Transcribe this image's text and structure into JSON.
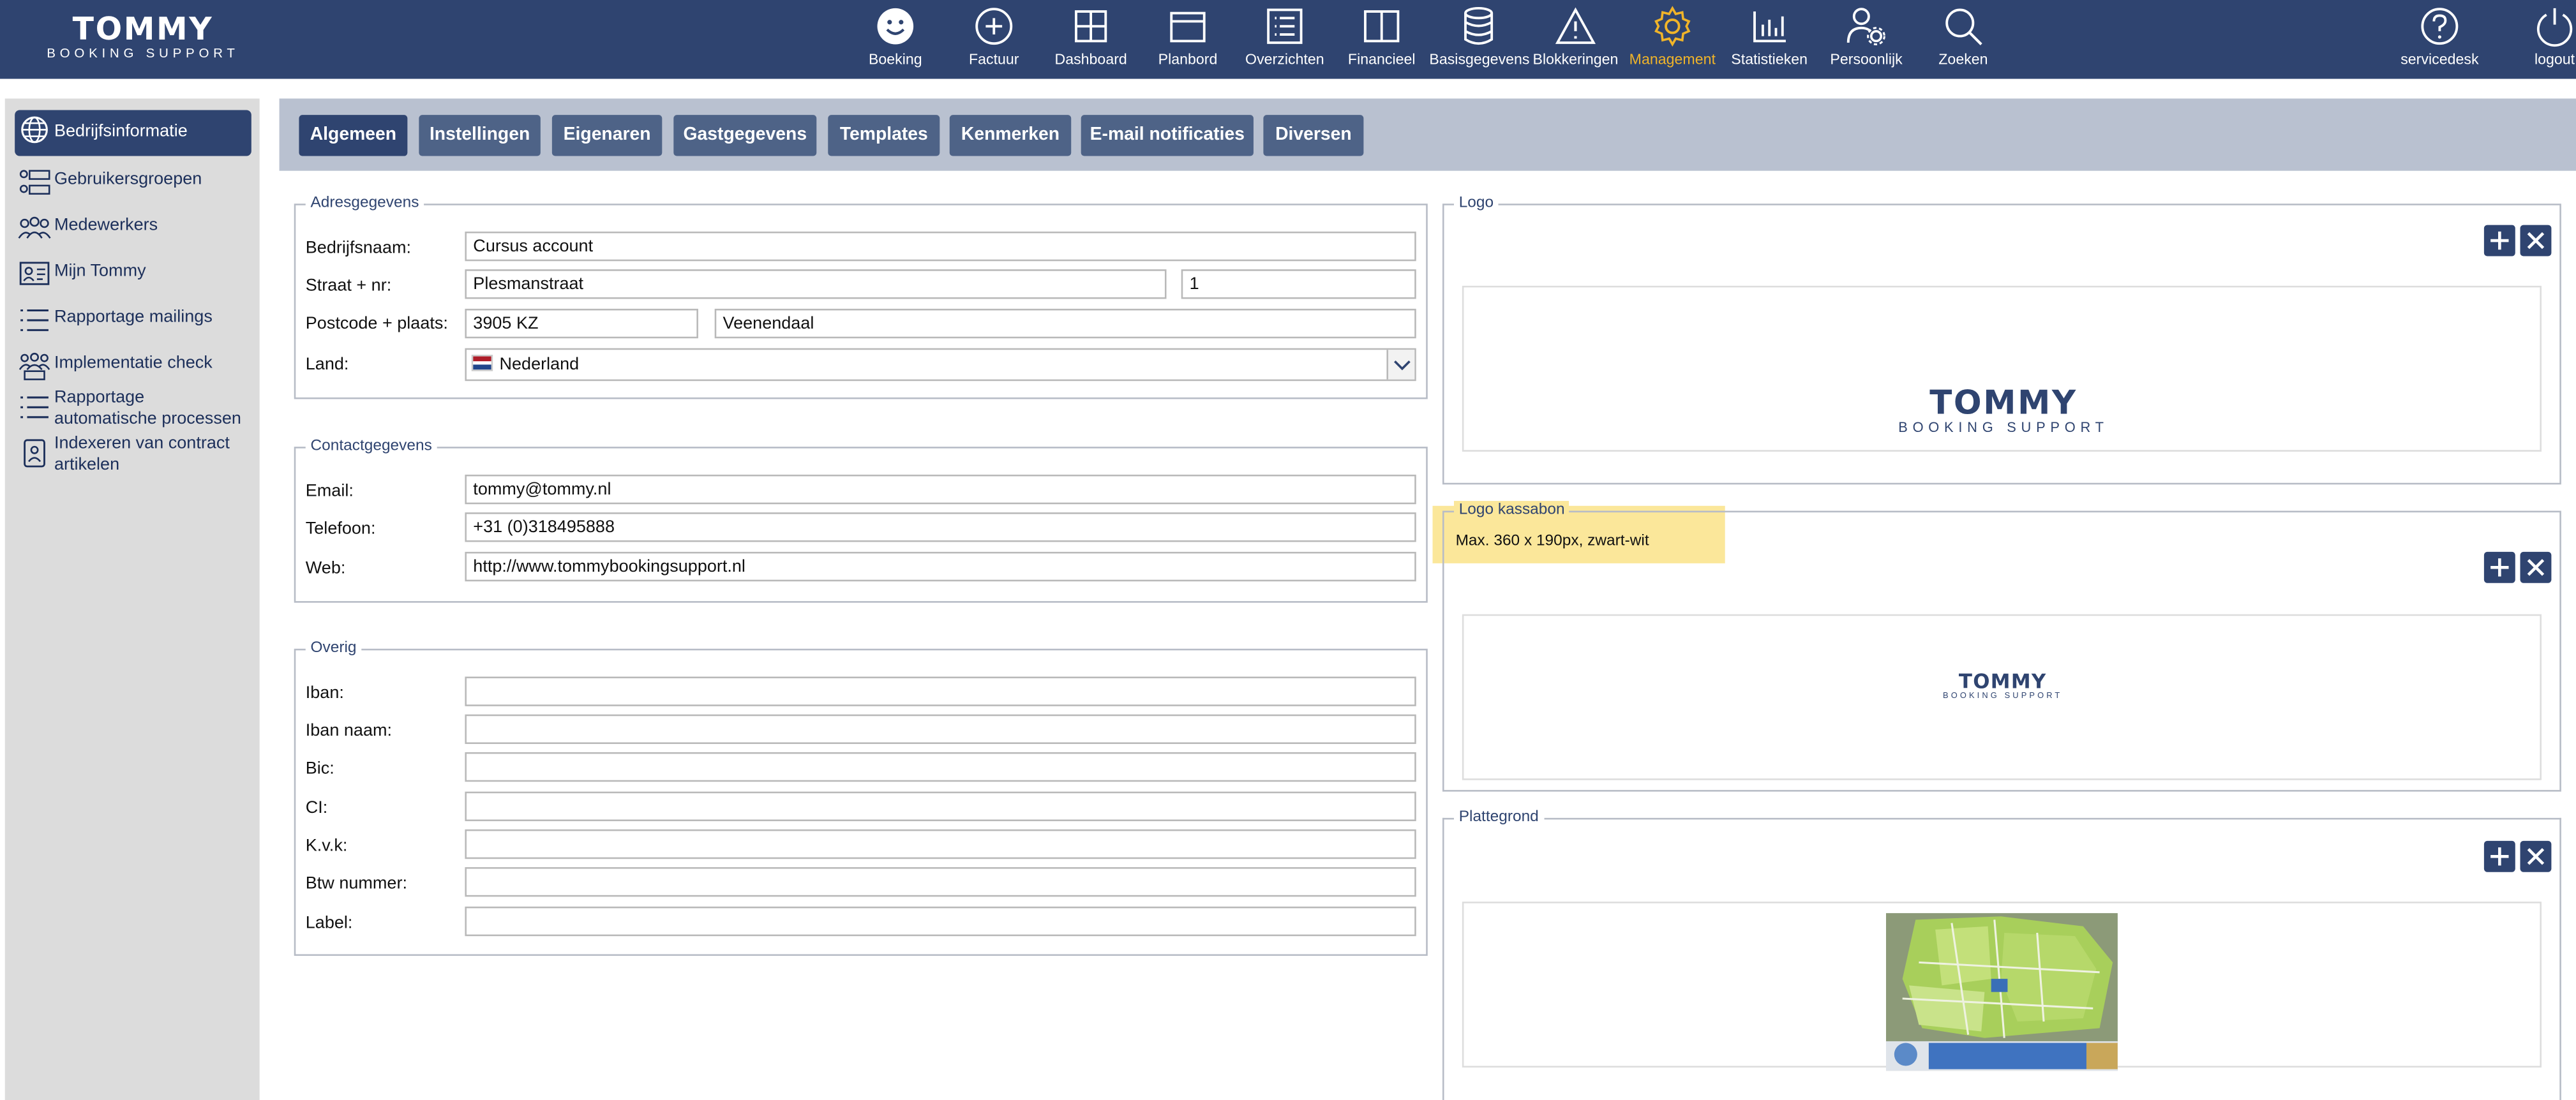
{
  "app": {
    "brand": "TOMMY",
    "brand_sub": "BOOKING SUPPORT"
  },
  "nav": {
    "items": [
      {
        "label": "Boeking",
        "icon": "smiley-icon"
      },
      {
        "label": "Factuur",
        "icon": "plus-circle-icon"
      },
      {
        "label": "Dashboard",
        "icon": "grid-icon"
      },
      {
        "label": "Planbord",
        "icon": "planboard-icon"
      },
      {
        "label": "Overzichten",
        "icon": "list-icon"
      },
      {
        "label": "Financieel",
        "icon": "book-icon"
      },
      {
        "label": "Basisgegevens",
        "icon": "database-icon"
      },
      {
        "label": "Blokkeringen",
        "icon": "warning-icon"
      },
      {
        "label": "Management",
        "icon": "gear-icon",
        "active": true
      },
      {
        "label": "Statistieken",
        "icon": "bar-chart-icon"
      },
      {
        "label": "Persoonlijk",
        "icon": "user-gear-icon"
      },
      {
        "label": "Zoeken",
        "icon": "search-icon"
      },
      {
        "label": "servicedesk",
        "icon": "help-icon"
      },
      {
        "label": "logout",
        "icon": "power-icon"
      }
    ],
    "active_color": "#f0b429",
    "bar_color": "#2f4470"
  },
  "sidebar": {
    "items": [
      {
        "label": "Bedrijfsinformatie",
        "icon": "globe-icon",
        "active": true
      },
      {
        "label": "Gebruikersgroepen",
        "icon": "groups-icon"
      },
      {
        "label": "Medewerkers",
        "icon": "people-icon"
      },
      {
        "label": "Mijn Tommy",
        "icon": "id-card-icon"
      },
      {
        "label": "Rapportage mailings",
        "icon": "list-icon"
      },
      {
        "label": "Implementatie check",
        "icon": "people-check-icon"
      },
      {
        "label": "Rapportage automatische processen",
        "icon": "list-icon"
      },
      {
        "label": "Indexeren van contract artikelen",
        "icon": "contract-icon"
      }
    ]
  },
  "tabs": [
    {
      "label": "Algemeen",
      "active": true
    },
    {
      "label": "Instellingen"
    },
    {
      "label": "Eigenaren"
    },
    {
      "label": "Gastgegevens"
    },
    {
      "label": "Templates"
    },
    {
      "label": "Kenmerken"
    },
    {
      "label": "E-mail notificaties"
    },
    {
      "label": "Diversen"
    }
  ],
  "address": {
    "legend": "Adresgegevens",
    "company_label": "Bedrijfsnaam:",
    "company_value": "Cursus account",
    "street_label": "Straat + nr:",
    "street_value": "Plesmanstraat",
    "number_value": "1",
    "postal_label": "Postcode + plaats:",
    "postal_value": "3905 KZ",
    "city_value": "Veenendaal",
    "country_label": "Land:",
    "country_value": "Nederland"
  },
  "contact": {
    "legend": "Contactgegevens",
    "email_label": "Email:",
    "email_value": "tommy@tommy.nl",
    "phone_label": "Telefoon:",
    "phone_value": "+31 (0)318495888",
    "web_label": "Web:",
    "web_value": "http://www.tommybookingsupport.nl"
  },
  "other": {
    "legend": "Overig",
    "fields": [
      {
        "label": "Iban:",
        "value": ""
      },
      {
        "label": "Iban naam:",
        "value": ""
      },
      {
        "label": "Bic:",
        "value": ""
      },
      {
        "label": "CI:",
        "value": ""
      },
      {
        "label": "K.v.k:",
        "value": ""
      },
      {
        "label": "Btw nummer:",
        "value": ""
      },
      {
        "label": "Label:",
        "value": ""
      }
    ]
  },
  "logo": {
    "legend": "Logo",
    "image_brand": "TOMMY",
    "image_sub": "BOOKING SUPPORT"
  },
  "logo_receipt": {
    "legend": "Logo kassabon",
    "hint": "Max. 360 x 190px, zwart-wit",
    "image_brand": "TOMMY",
    "image_sub": "BOOKING SUPPORT"
  },
  "floorplan": {
    "legend": "Plattegrond"
  }
}
